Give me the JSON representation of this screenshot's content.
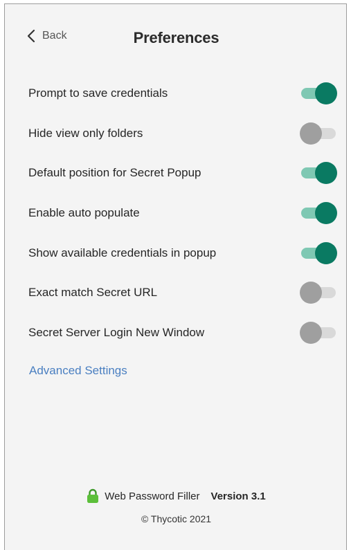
{
  "header": {
    "back_label": "Back",
    "title": "Preferences"
  },
  "settings": [
    {
      "label": "Prompt to save credentials",
      "enabled": true
    },
    {
      "label": "Hide view only folders",
      "enabled": false
    },
    {
      "label": "Default position for Secret Popup",
      "enabled": true
    },
    {
      "label": "Enable auto populate",
      "enabled": true
    },
    {
      "label": "Show available credentials in popup",
      "enabled": true
    },
    {
      "label": "Exact match Secret URL",
      "enabled": false
    },
    {
      "label": "Secret Server Login New Window",
      "enabled": false
    }
  ],
  "advanced_link": "Advanced Settings",
  "footer": {
    "product": "Web Password Filler",
    "version": "Version 3.1",
    "copyright": "© Thycotic 2021"
  },
  "icons": {
    "back": "chevron-left-icon",
    "product": "lock-icon"
  },
  "colors": {
    "toggle_on_knob": "#0a7a62",
    "toggle_on_track": "#7fc8b3",
    "toggle_off_knob": "#9f9f9f",
    "toggle_off_track": "#d9d9d9",
    "link": "#4a7fc1",
    "lock": "#5cbf3a"
  }
}
